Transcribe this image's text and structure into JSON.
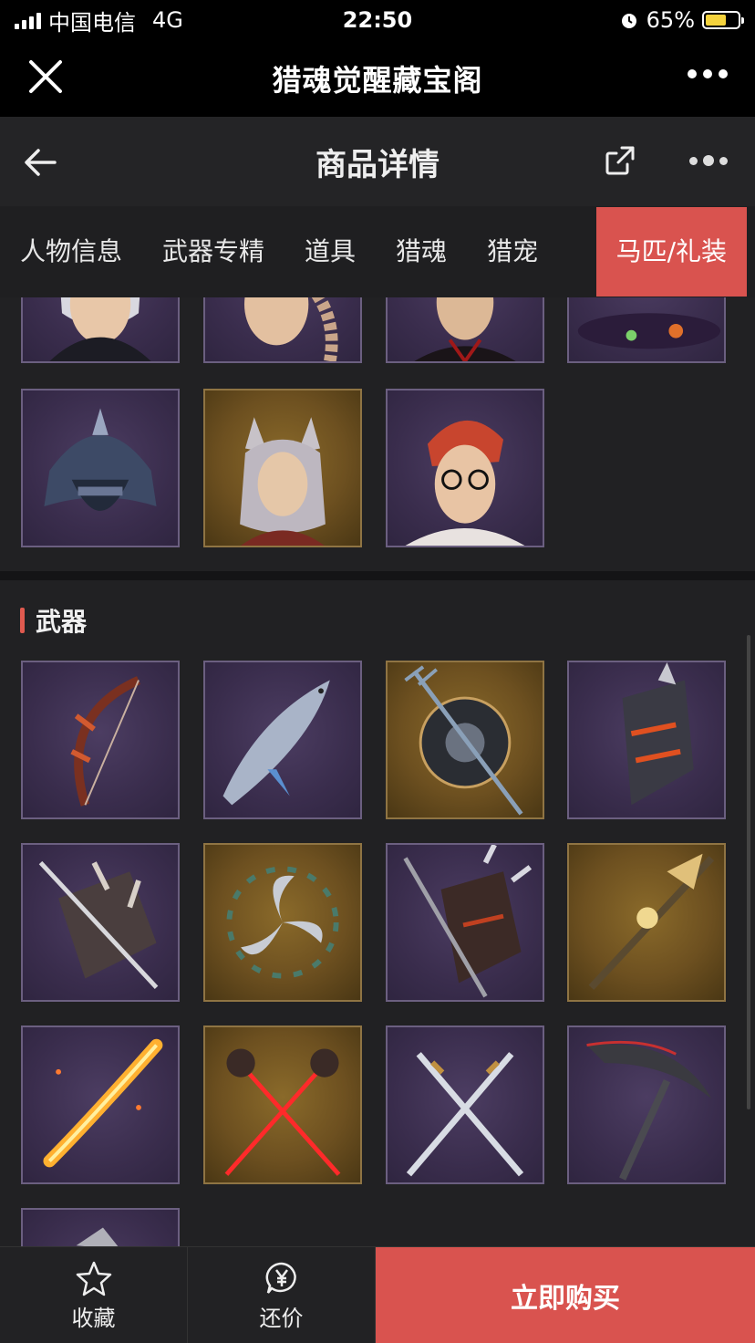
{
  "status_bar": {
    "carrier": "中国电信",
    "network": "4G",
    "time": "22:50",
    "battery": "65%",
    "battery_level": 0.65
  },
  "app_bar": {
    "title": "猎魂觉醒藏宝阁",
    "close_icon": "close-icon",
    "more_icon": "more-icon"
  },
  "page_bar": {
    "title": "商品详情",
    "back_icon": "back-arrow-icon",
    "share_icon": "share-icon",
    "menu_icon": "more-icon"
  },
  "tabs": [
    {
      "label": "人物信息",
      "active": false
    },
    {
      "label": "武器专精",
      "active": false
    },
    {
      "label": "道具",
      "active": false
    },
    {
      "label": "猎魂",
      "active": false
    },
    {
      "label": "猎宠",
      "active": false
    },
    {
      "label": "马匹/礼装",
      "active": true
    }
  ],
  "outfits": {
    "items": [
      {
        "icon": "character-white-hair-icon",
        "rarity": "purple"
      },
      {
        "icon": "character-braided-hair-icon",
        "rarity": "purple"
      },
      {
        "icon": "character-dark-hair-icon",
        "rarity": "purple"
      },
      {
        "icon": "witch-hat-icon",
        "rarity": "purple"
      },
      {
        "icon": "samurai-helmet-icon",
        "rarity": "purple"
      },
      {
        "icon": "fox-ears-character-icon",
        "rarity": "gold"
      },
      {
        "icon": "red-hair-glasses-character-icon",
        "rarity": "purple"
      }
    ]
  },
  "weapons": {
    "title": "武器",
    "items": [
      {
        "icon": "bow-icon",
        "rarity": "purple"
      },
      {
        "icon": "fish-weapon-icon",
        "rarity": "purple"
      },
      {
        "icon": "trident-shield-icon",
        "rarity": "gold"
      },
      {
        "icon": "gauntlet-icon",
        "rarity": "purple"
      },
      {
        "icon": "spiked-gauntlet-icon",
        "rarity": "purple"
      },
      {
        "icon": "spinning-blade-icon",
        "rarity": "gold"
      },
      {
        "icon": "spear-shield-icon",
        "rarity": "purple"
      },
      {
        "icon": "golden-spear-icon",
        "rarity": "gold"
      },
      {
        "icon": "fire-sword-icon",
        "rarity": "purple"
      },
      {
        "icon": "crossed-red-blades-icon",
        "rarity": "gold"
      },
      {
        "icon": "crossed-katanas-icon",
        "rarity": "purple"
      },
      {
        "icon": "scythe-icon",
        "rarity": "purple"
      },
      {
        "icon": "partial-weapon-icon",
        "rarity": "purple"
      }
    ]
  },
  "bottom_bar": {
    "favorite_label": "收藏",
    "favorite_icon": "star-icon",
    "bargain_label": "还价",
    "bargain_icon": "yen-bubble-icon",
    "buy_label": "立即购买"
  },
  "colors": {
    "accent": "#d9534f",
    "battery_fill": "#f5d33d",
    "tile_purple": "#3a2d4d",
    "tile_gold": "#6d5020"
  }
}
